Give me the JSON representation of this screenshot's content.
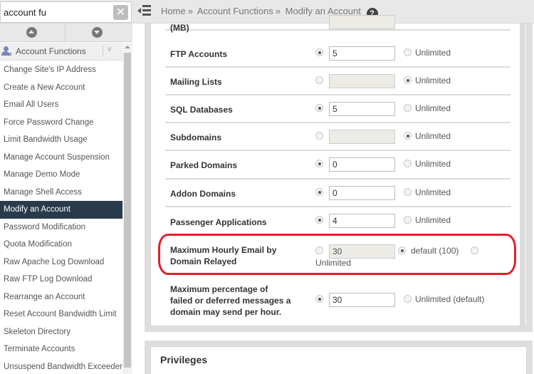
{
  "search": {
    "value": "account fu",
    "clear_icon": "close-icon"
  },
  "header": {
    "menu_icon": "collapse-menu-icon",
    "breadcrumb": [
      "Home",
      "Account Functions",
      "Modify an Account"
    ],
    "separator": "»",
    "help_icon": "?"
  },
  "sidebar": {
    "category": "Account Functions",
    "category_chevron": "v",
    "items": [
      {
        "label": "Change Site's IP Address"
      },
      {
        "label": "Create a New Account"
      },
      {
        "label": "Email All Users"
      },
      {
        "label": "Force Password Change"
      },
      {
        "label": "Limit Bandwidth Usage"
      },
      {
        "label": "Manage Account Suspension"
      },
      {
        "label": "Manage Demo Mode"
      },
      {
        "label": "Manage Shell Access"
      },
      {
        "label": "Modify an Account",
        "active": true
      },
      {
        "label": "Password Modification"
      },
      {
        "label": "Quota Modification"
      },
      {
        "label": "Raw Apache Log Download"
      },
      {
        "label": "Raw FTP Log Download"
      },
      {
        "label": "Rearrange an Account"
      },
      {
        "label": "Reset Account Bandwidth Limit"
      },
      {
        "label": "Skeleton Directory"
      },
      {
        "label": "Terminate Accounts"
      },
      {
        "label": "Unsuspend Bandwidth Exceeders"
      }
    ]
  },
  "form": {
    "partial_label": "(MB)",
    "rows": [
      {
        "label": "FTP Accounts",
        "value": "5",
        "limited": true,
        "unlimited_label": "Unlimited"
      },
      {
        "label": "Mailing Lists",
        "value": "",
        "limited": false,
        "unlimited_label": "Unlimited"
      },
      {
        "label": "SQL Databases",
        "value": "5",
        "limited": true,
        "unlimited_label": "Unlimited"
      },
      {
        "label": "Subdomains",
        "value": "",
        "limited": false,
        "unlimited_label": "Unlimited"
      },
      {
        "label": "Parked Domains",
        "value": "0",
        "limited": true,
        "unlimited_label": "Unlimited"
      },
      {
        "label": "Addon Domains",
        "value": "0",
        "limited": true,
        "unlimited_label": "Unlimited"
      },
      {
        "label": "Passenger Applications",
        "value": "4",
        "limited": true,
        "unlimited_label": "Unlimited"
      }
    ],
    "hourly_email": {
      "label_line1": "Maximum Hourly Email by",
      "label_line2": "Domain Relayed",
      "value": "30",
      "selected": "default",
      "default_label": "default (100)",
      "unlimited_label": "Unlimited"
    },
    "failed_pct": {
      "label_line1": "Maximum percentage of",
      "label_line2": "failed or deferred messages a",
      "label_line3": "domain may send per hour.",
      "value": "30",
      "selected": "custom",
      "unlimited_label": "Unlimited (default)"
    }
  },
  "privileges": {
    "title": "Privileges"
  },
  "annotation": {
    "color": "#e0202a"
  }
}
